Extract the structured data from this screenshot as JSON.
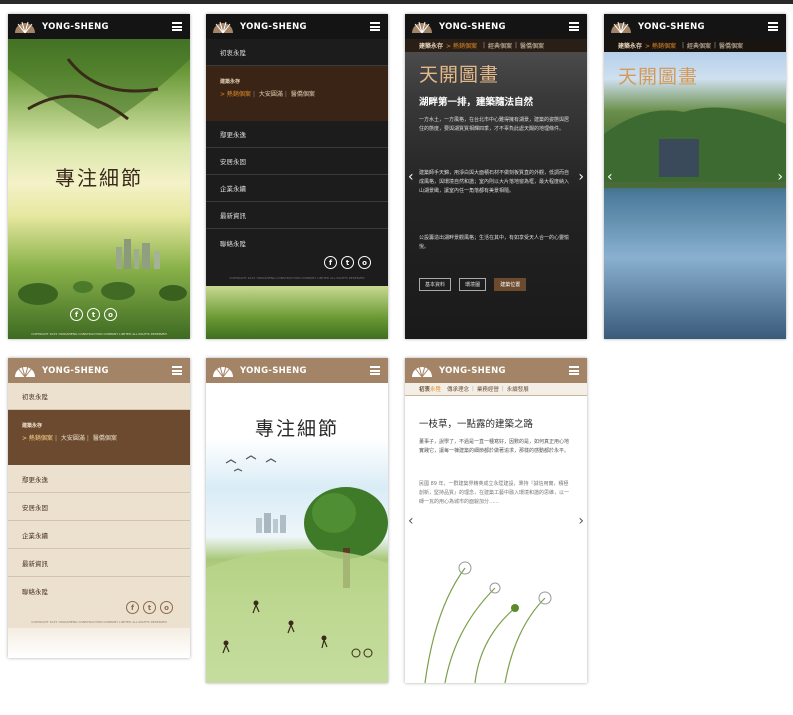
{
  "brand": "YONG-SHENG",
  "hero_title": "專注細節",
  "gallery_title": "天開圖畫",
  "menu": {
    "items_top": [
      "初衷永陞"
    ],
    "submenu_title": "建築永存",
    "submenu_links": [
      "> 熱銷個案",
      "大安圓滿",
      "醫僑個案"
    ],
    "items_bottom": [
      "鄢更永逸",
      "安居永固",
      "企業永續",
      "最新資訊",
      "聯絡永陞"
    ]
  },
  "crumb": {
    "root": "建築永存",
    "current": "熱銷個案",
    "links": [
      "經典個案",
      "醫僑個案"
    ]
  },
  "article_dark": {
    "heading": "湖畔第一排，建築隨法自然",
    "para1": "一方水土，一方風格，在台北市中心難得擁有湖景，建築的姿態與居住的態度，要與湖質質相輝四季，才不辜負此處天賜的地理條件。",
    "para2": "建築師手天錦，用淨白與大面積石材不做刻板質直的外觀，低調而自成風格，與環境自然和諧；室內則以大片落地窗為框，最大程度納入山湖景緻，讓室內任一角落都有美景相隨。",
    "para3": "公設籌造出湖畔景觀風格；生活在其中，有如享受天人合一的心靈愉悅。",
    "buttons": [
      "基本資料",
      "環境圖",
      "建築位置"
    ]
  },
  "article_light": {
    "crumb_root": "初衷",
    "crumb_current": "永陞",
    "crumb_links": [
      "傳承理念",
      "業務經營",
      "永續發展"
    ],
    "heading": "一枝草，一點露的建築之路",
    "para1": "董事子，說學了，不過是一直一種寫好，因數的是，如何真正用心地實踐它，讓每一棟建築的細節都於做著追求，那樣的感動都於永平。",
    "para2": "民國 89 年，一群建築界精英成立永陞建設，秉持『誠信用實，積極創新，堅持品質』的理念，在建築工藝中融入環境和諧的思維，以一磚一瓦的用心為城市的面貌加分……"
  },
  "social": [
    "f",
    "t",
    "o"
  ],
  "copyright": "COPYRIGHT 2015 YONGSHENG CONSTRUCTION COMPANY LIMITED ALL RIGHTS RESERVED"
}
